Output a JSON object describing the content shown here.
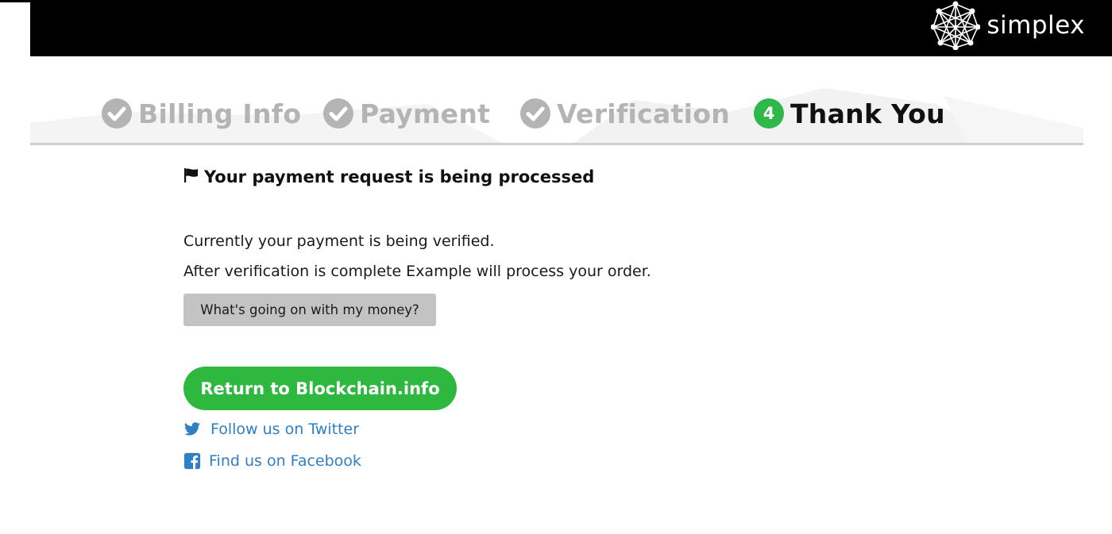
{
  "header": {
    "brand_name": "simplex",
    "logo_icon": "simplex-network-logo"
  },
  "steps": [
    {
      "label": "Billing Info",
      "state": "completed",
      "icon": "check-circle-icon"
    },
    {
      "label": "Payment",
      "state": "completed",
      "icon": "check-circle-icon"
    },
    {
      "label": "Verification",
      "state": "completed",
      "icon": "check-circle-icon"
    },
    {
      "label": "Thank You",
      "state": "active",
      "number": "4"
    }
  ],
  "main": {
    "heading_icon": "flag-icon",
    "heading": "Your payment request is being processed",
    "line1": "Currently your payment is being verified.",
    "line2": "After verification is complete Example will process your order.",
    "info_button": "What's going on with my money?",
    "return_button": "Return to Blockchain.info",
    "twitter_link": "Follow us on Twitter",
    "facebook_link": "Find us on Facebook"
  },
  "colors": {
    "accent_green": "#2fb840",
    "link_blue": "#2f7fc4",
    "inactive_gray": "#b4b4b4",
    "topbar": "#000000"
  }
}
